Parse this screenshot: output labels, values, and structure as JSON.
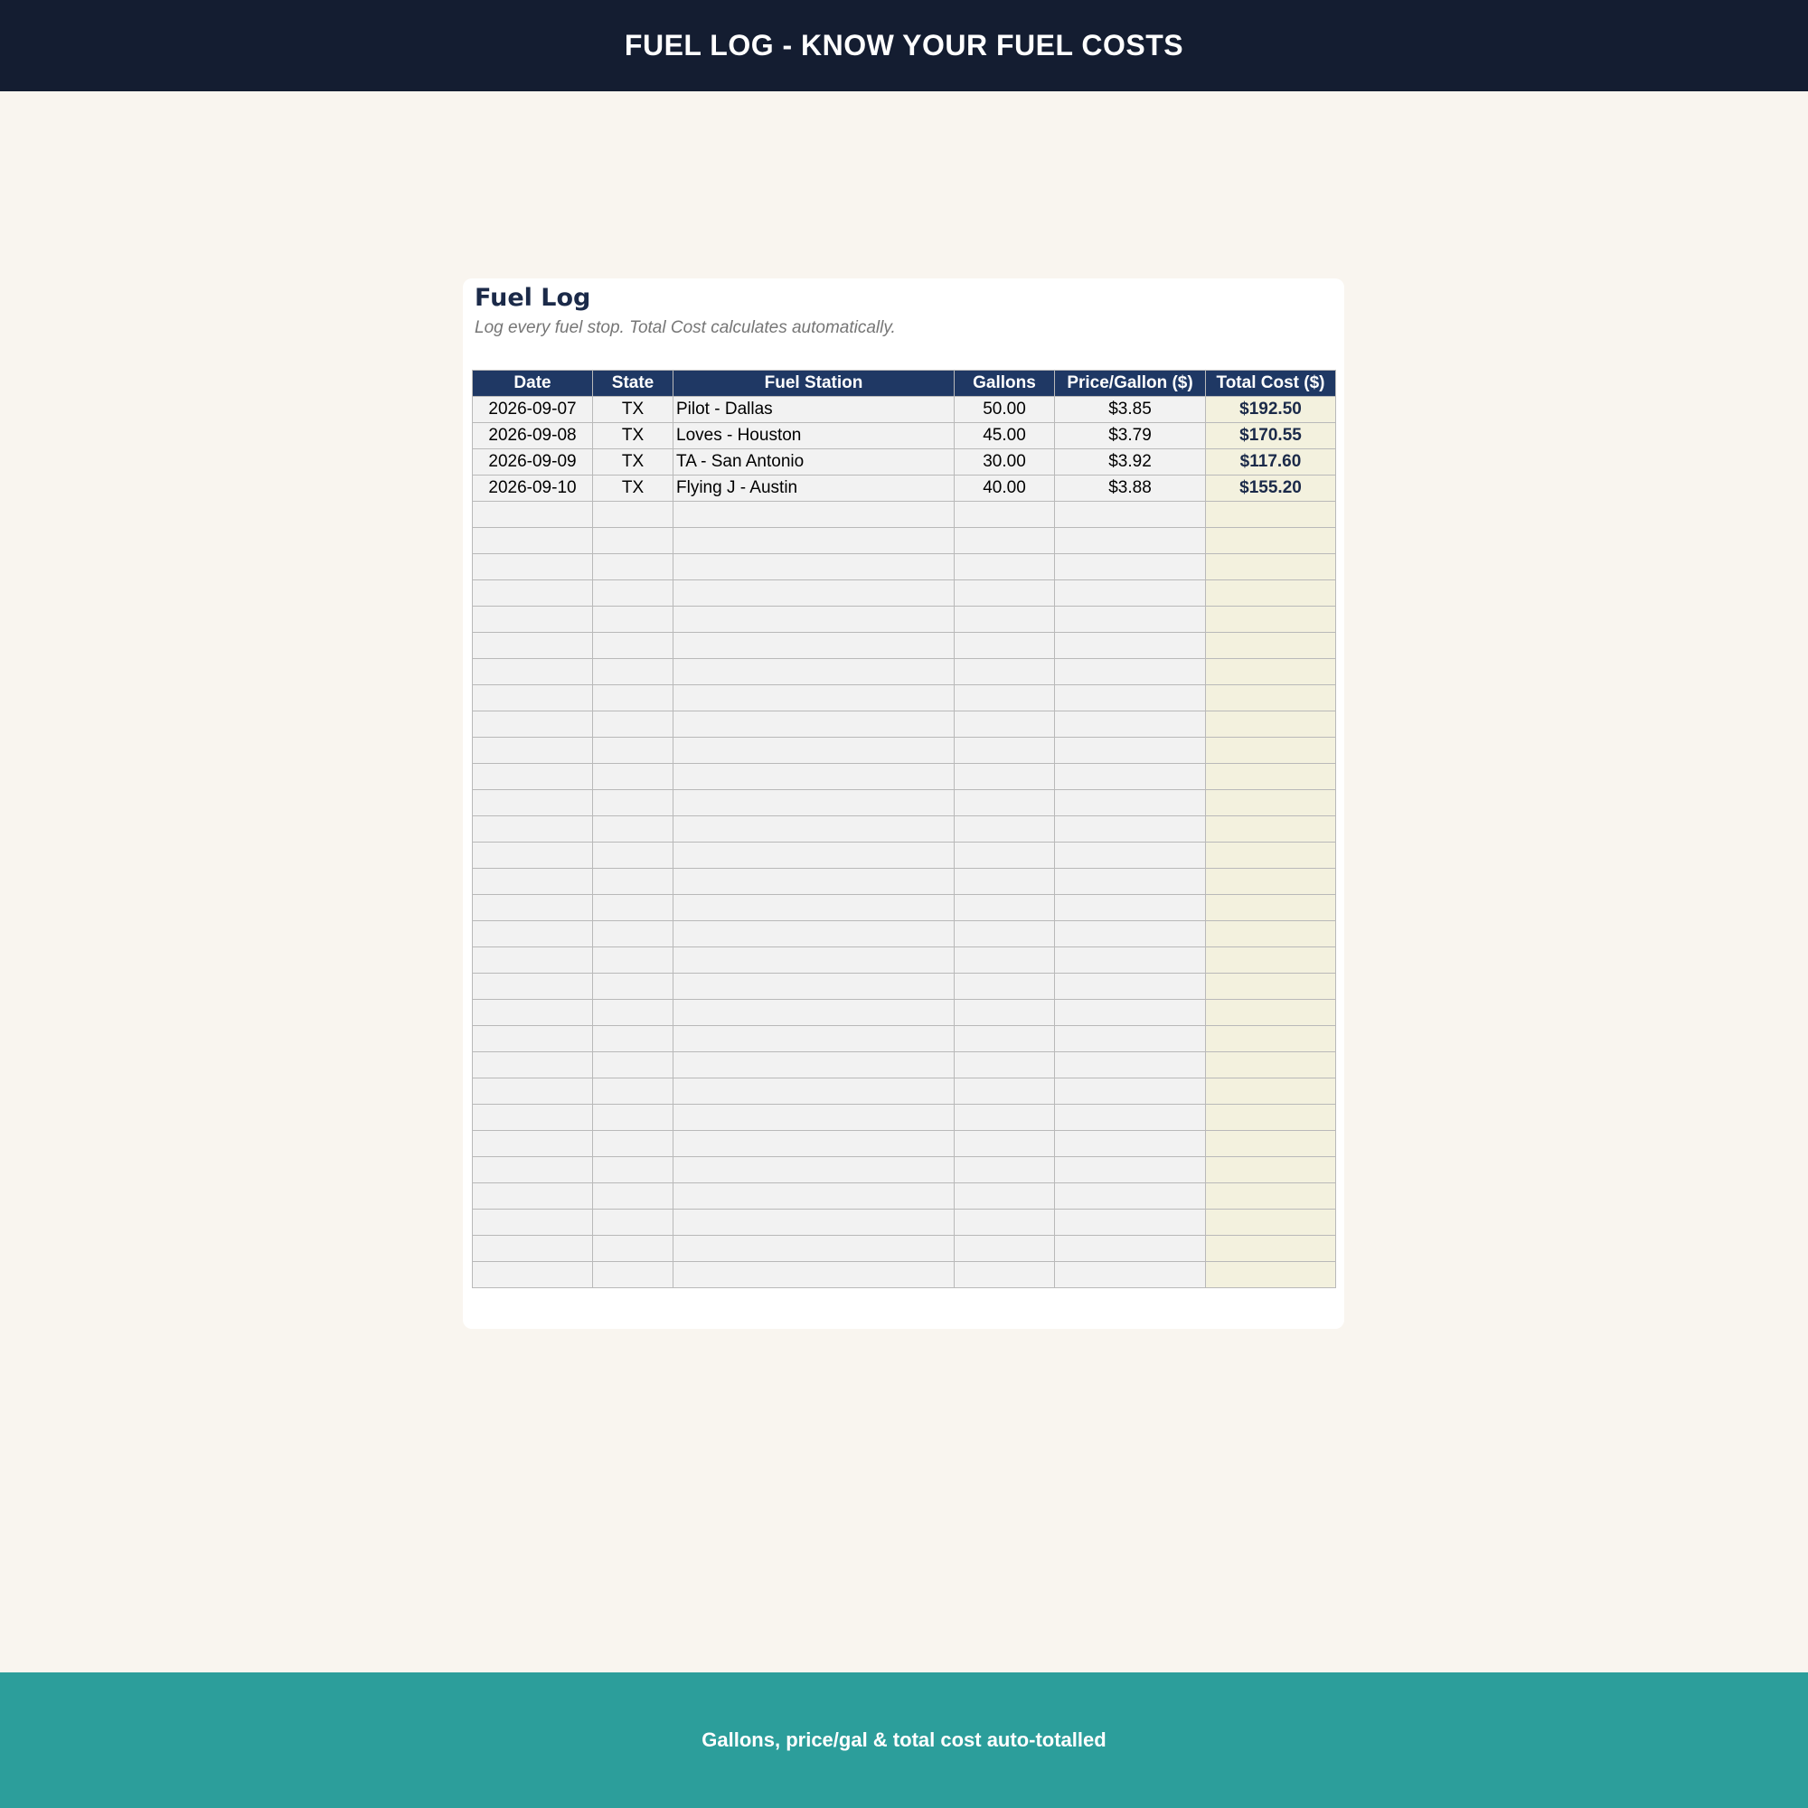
{
  "header": {
    "title": "FUEL LOG - KNOW YOUR FUEL COSTS"
  },
  "card": {
    "title": "Fuel Log",
    "subtitle": "Log every fuel stop. Total Cost calculates automatically."
  },
  "table": {
    "columns": [
      "Date",
      "State",
      "Fuel Station",
      "Gallons",
      "Price/Gallon ($)",
      "Total Cost ($)"
    ],
    "rows": [
      [
        "2026-09-07",
        "TX",
        "Pilot - Dallas",
        "50.00",
        "$3.85",
        "$192.50"
      ],
      [
        "2026-09-08",
        "TX",
        "Loves - Houston",
        "45.00",
        "$3.79",
        "$170.55"
      ],
      [
        "2026-09-09",
        "TX",
        "TA - San Antonio",
        "30.00",
        "$3.92",
        "$117.60"
      ],
      [
        "2026-09-10",
        "TX",
        "Flying J - Austin",
        "40.00",
        "$3.88",
        "$155.20"
      ]
    ],
    "empty_row_count": 30
  },
  "footer": {
    "text": "Gallons, price/gal & total cost auto-totalled"
  },
  "colors": {
    "header_bg": "#141d31",
    "table_header_bg": "#1f3864",
    "total_column_bg": "#f3f1de",
    "footer_bg": "#2c9e9b",
    "page_bg": "#f9f5ef"
  }
}
